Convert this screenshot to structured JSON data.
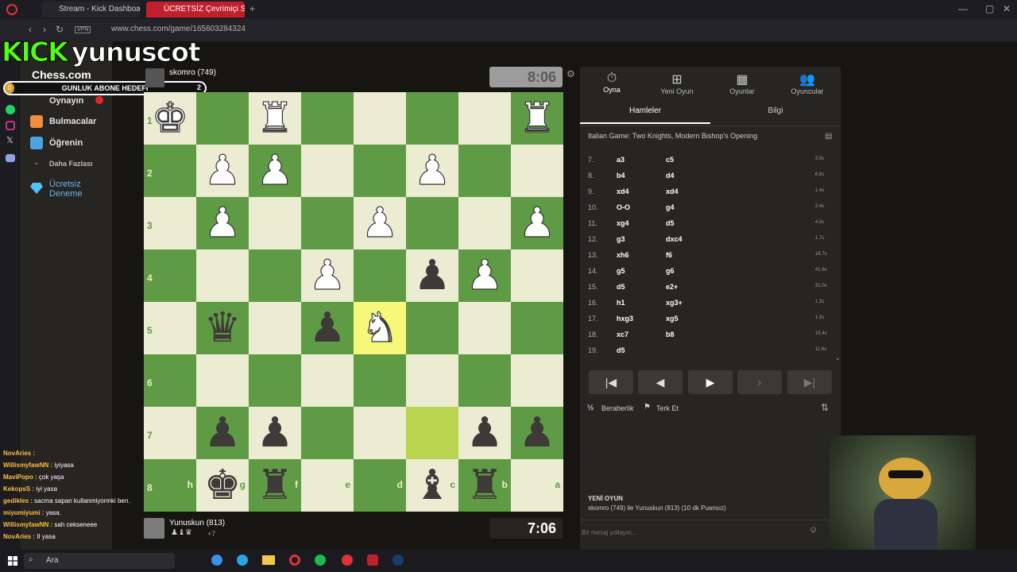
{
  "browser": {
    "tab1": "Stream - Kick Dashboard",
    "tab2": "ÜCRETSİZ Çevrimiçi Satranç",
    "url": "www.chess.com/game/165603284324",
    "vpn": "VPN"
  },
  "overlay": {
    "kick": "KICK",
    "username": "yunuscot",
    "subgoal": "GUNLUK ABONE HEDEFI",
    "subgoal_start": "0",
    "subgoal_target": "2"
  },
  "sidebar": {
    "logo": "Chess.com",
    "items": [
      "Oynayın",
      "Bulmacalar",
      "Öğrenin",
      "Daha Fazlası",
      "Ücretsiz Deneme"
    ]
  },
  "top_player": {
    "name": "skomro (749)",
    "clock": "8:06"
  },
  "bottom_player": {
    "name": "Yunuskun (813)",
    "clock": "7:06",
    "material": "+7"
  },
  "board": {
    "ranks": [
      "1",
      "2",
      "3",
      "4",
      "5",
      "6",
      "7",
      "8"
    ],
    "files": [
      "h",
      "g",
      "f",
      "e",
      "d",
      "c",
      "b",
      "a"
    ],
    "rows": [
      [
        "wK",
        "",
        "wR",
        "",
        "",
        "",
        "",
        "wR"
      ],
      [
        "",
        "wP",
        "wP",
        "",
        "",
        "wP",
        "",
        ""
      ],
      [
        "",
        "wP",
        "",
        "",
        "wP",
        "",
        "",
        "wP"
      ],
      [
        "",
        "",
        "",
        "wP",
        "",
        "bP",
        "wP",
        ""
      ],
      [
        "",
        "bQ",
        "",
        "bP",
        "wN",
        "",
        "",
        ""
      ],
      [
        "",
        "",
        "",
        "",
        "",
        "",
        "",
        ""
      ],
      [
        "",
        "bP",
        "bP",
        "",
        "",
        "",
        "bP",
        "bP"
      ],
      [
        "",
        "bK",
        "bR",
        "",
        "",
        "bB",
        "bR",
        ""
      ]
    ],
    "highlights": [
      [
        4,
        4,
        "hl1"
      ],
      [
        6,
        5,
        "hl2"
      ]
    ]
  },
  "panel": {
    "tabs": [
      "Oyna",
      "Yeni Oyun",
      "Oyunlar",
      "Oyuncular"
    ],
    "moves_tab": "Hamleler",
    "info_tab": "Bilgi",
    "opening": "Italian Game: Two Knights, Modern Bishop's Opening",
    "moves": [
      {
        "n": "7.",
        "w": "a3",
        "b": "c5",
        "t": "3.9s"
      },
      {
        "n": "8.",
        "w": "b4",
        "b": "d4",
        "t": "6.6s"
      },
      {
        "n": "9.",
        "w": "xd4",
        "b": "xd4",
        "t": "1.4s"
      },
      {
        "n": "10.",
        "w": "O-O",
        "b": "g4",
        "t": "2.4s"
      },
      {
        "n": "11.",
        "w": "xg4",
        "b": "d5",
        "t": "4.5s"
      },
      {
        "n": "12.",
        "w": "g3",
        "b": "dxc4",
        "t": "1.7s"
      },
      {
        "n": "13.",
        "w": "xh6",
        "b": "f6",
        "t": "16.7s"
      },
      {
        "n": "14.",
        "w": "g5",
        "b": "g6",
        "t": "41.6s"
      },
      {
        "n": "15.",
        "w": "d5",
        "b": "e2+",
        "t": "31.0s"
      },
      {
        "n": "16.",
        "w": "h1",
        "b": "xg3+",
        "t": "1.3s"
      },
      {
        "n": "17.",
        "w": "hxg3",
        "b": "xg5",
        "t": "1.3s"
      },
      {
        "n": "18.",
        "w": "xc7",
        "b": "b8",
        "t": "15.4s"
      },
      {
        "n": "19.",
        "w": "d5",
        "b": "",
        "t": "11.6s"
      }
    ],
    "draw": "Beraberlik",
    "resign": "Terk Et",
    "new_game_title": "YENİ OYUN",
    "new_game_desc": "skomro (749) ile Yunuskun (813) (10 dk Puansız)",
    "message_placeholder": "Bir mesaj yollayın..."
  },
  "chat": [
    {
      "u": "NovAries :",
      "m": ""
    },
    {
      "u": "WillismyfawNN :",
      "m": "iyiyasa"
    },
    {
      "u": "MaviPopo :",
      "m": "çok yaşa"
    },
    {
      "u": "KekopsS :",
      "m": "iyi yasa"
    },
    {
      "u": "gedikles :",
      "m": "sacma sapan kullanmiyormki ben."
    },
    {
      "u": "miyumiyumi :",
      "m": "yasa."
    },
    {
      "u": "WillismyfawNN :",
      "m": "sah cekseneee"
    },
    {
      "u": "NovAries :",
      "m": "II yasa"
    }
  ],
  "taskbar": {
    "search": "Ara"
  }
}
